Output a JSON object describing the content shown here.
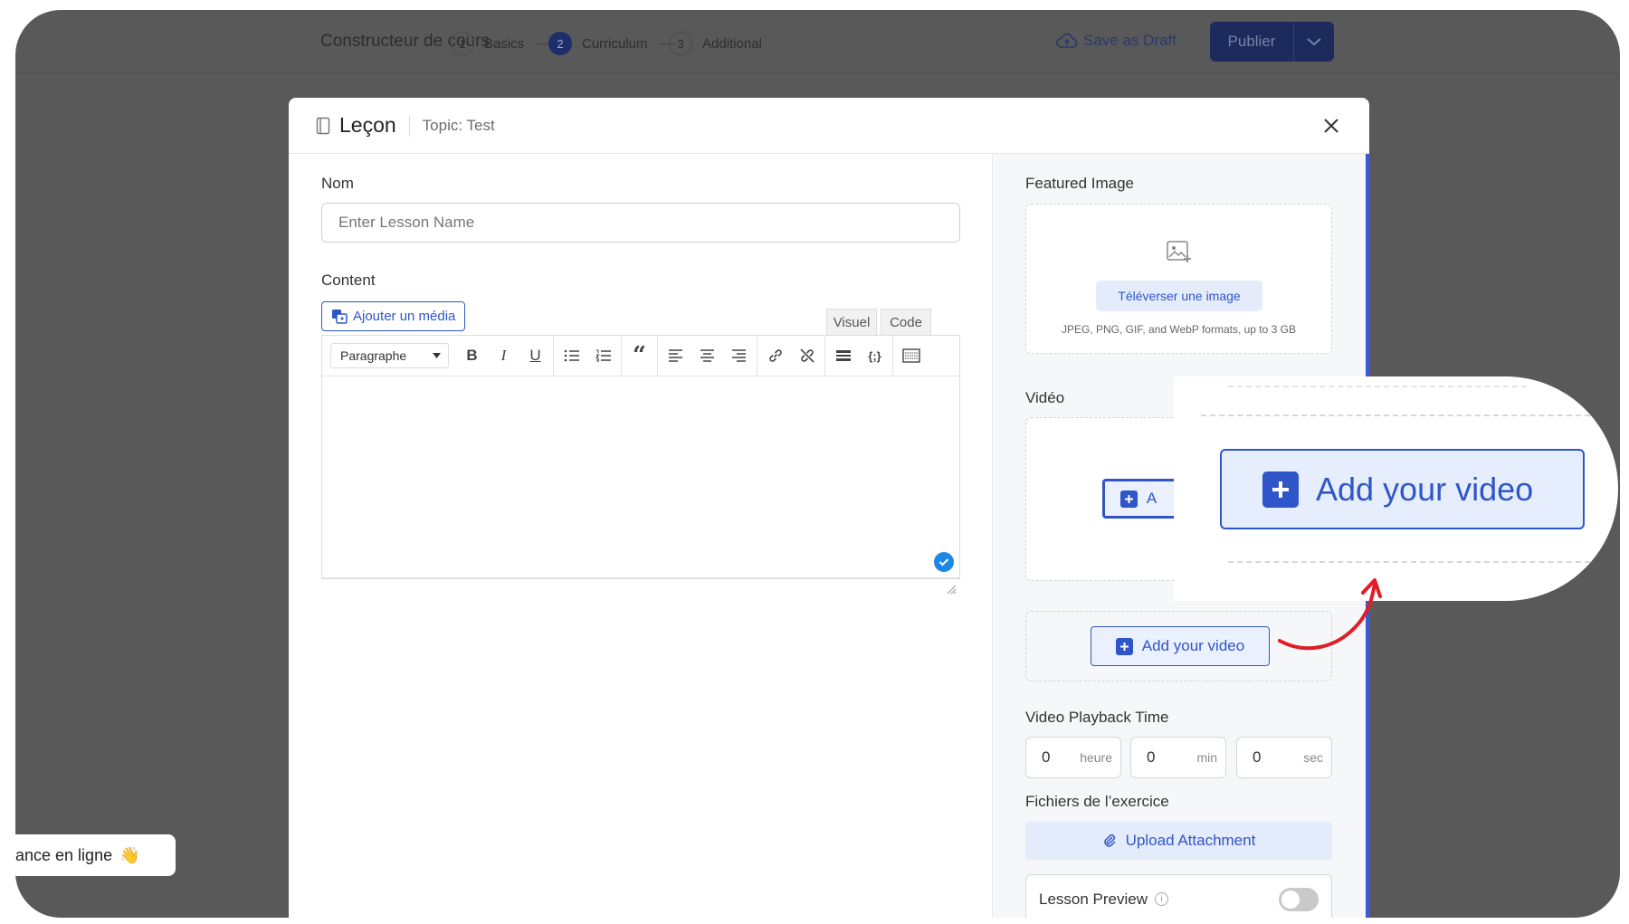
{
  "topbar": {
    "title": "Constructeur de cours",
    "steps": [
      {
        "num": "1",
        "label": "Basics"
      },
      {
        "num": "2",
        "label": "Curriculum"
      },
      {
        "num": "3",
        "label": "Additional"
      }
    ],
    "save_draft": "Save as Draft",
    "publish": "Publier"
  },
  "modal": {
    "title": "Leçon",
    "topic": "Topic: Test",
    "name_label": "Nom",
    "name_placeholder": "Enter Lesson Name",
    "content_label": "Content",
    "add_media": "Ajouter un média",
    "tab_visual": "Visuel",
    "tab_code": "Code",
    "paragraph_select": "Paragraphe"
  },
  "sidebar": {
    "featured_image_label": "Featured Image",
    "upload_image": "Téléverser une image",
    "image_note": "JPEG, PNG, GIF, and WebP formats, up to 3 GB",
    "video_label": "Vidéo",
    "add_video": "Add your video",
    "add_video_partial": "A",
    "playback_label": "Video Playback Time",
    "time": [
      {
        "value": "0",
        "unit": "heure"
      },
      {
        "value": "0",
        "unit": "min"
      },
      {
        "value": "0",
        "unit": "sec"
      }
    ],
    "exercise_files_label": "Fichiers de l’exercice",
    "upload_attachment": "Upload Attachment",
    "lesson_preview": "Lesson Preview",
    "lesson_preview_enabled": false
  },
  "zoom": {
    "add_video": "Add your video"
  },
  "toast": {
    "text": "ance en ligne",
    "emoji": "👋"
  },
  "colors": {
    "accent": "#2f56c9",
    "arrow": "#e01e26",
    "backdrop": "#595959"
  }
}
